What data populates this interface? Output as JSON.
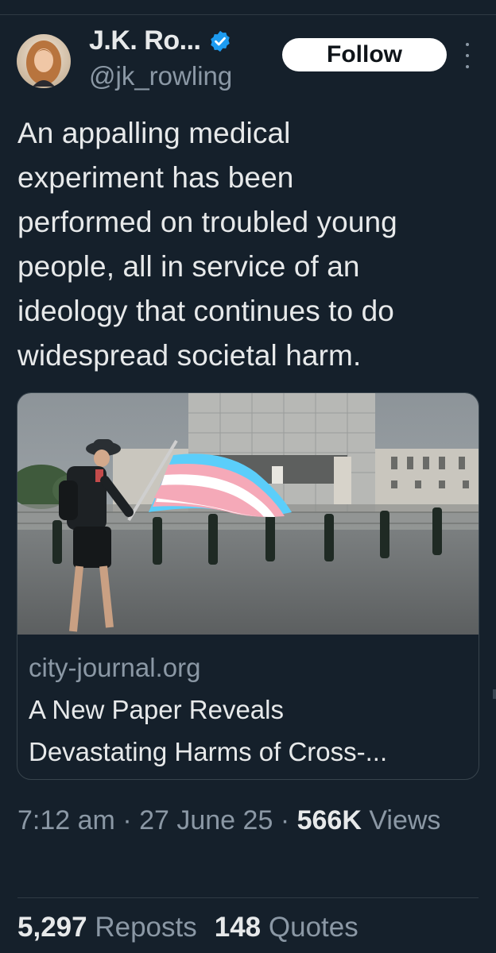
{
  "author": {
    "display_name": "J.K. Ro...",
    "handle": "@jk_rowling",
    "verified": true
  },
  "actions": {
    "follow_label": "Follow",
    "more_icon": "more-vertical-icon"
  },
  "tweet": {
    "lines": [
      "An appalling medical",
      "experiment has been",
      "performed on troubled young",
      "people, all in service of an",
      "ideology that continues to do",
      "widespread societal harm."
    ]
  },
  "card": {
    "domain": "city-journal.org",
    "title_lines": [
      "A New Paper Reveals",
      "Devastating Harms of Cross-..."
    ]
  },
  "meta": {
    "time": "7:12 am",
    "date": "27 June 25",
    "separator": "·",
    "views_count": "566K",
    "views_label": "Views"
  },
  "stats": {
    "reposts_count": "5,297",
    "reposts_label": "Reposts",
    "quotes_count": "148",
    "quotes_label": "Quotes"
  },
  "colors": {
    "background": "#15202b",
    "text_primary": "#e7e9ea",
    "text_secondary": "#8b98a5",
    "verified_blue": "#1d9bf0",
    "border": "#38444d"
  }
}
